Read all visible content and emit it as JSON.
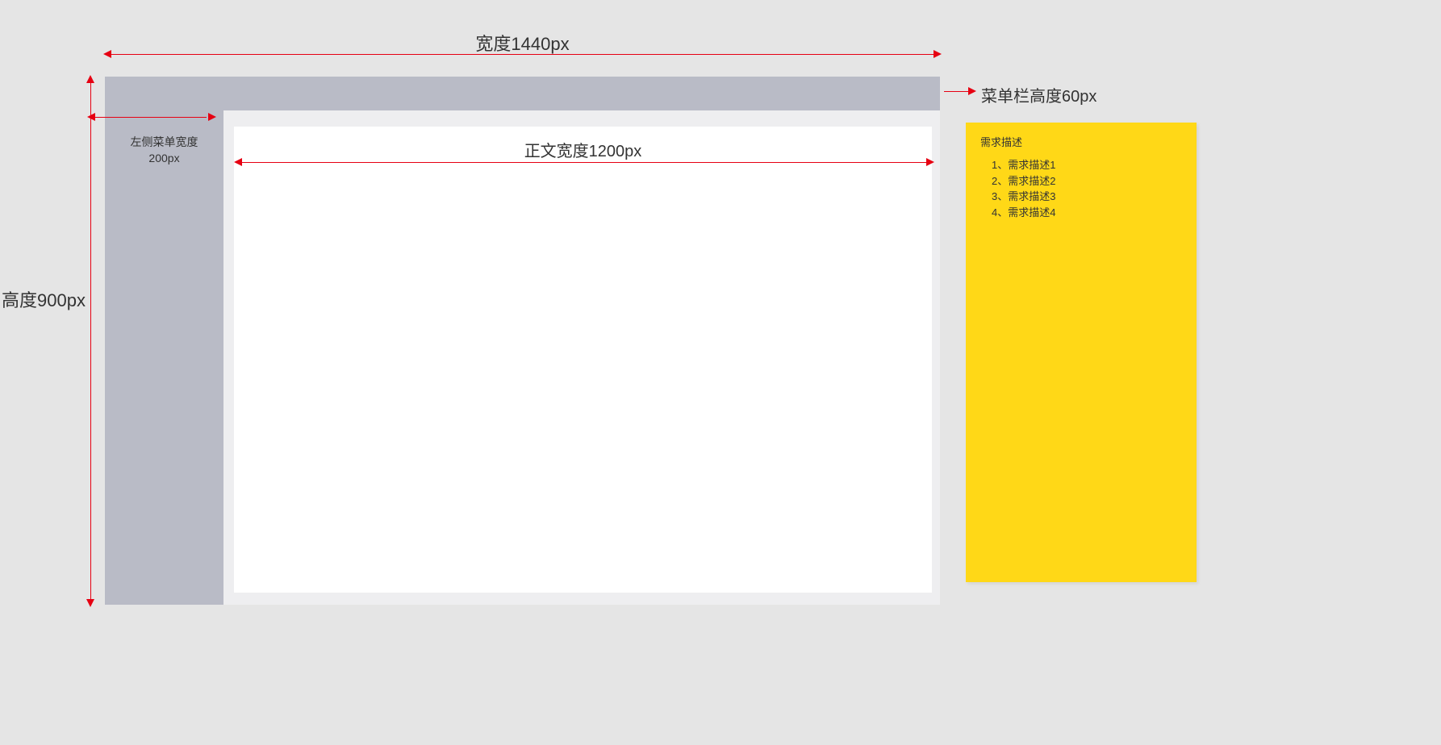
{
  "dimensions": {
    "total_width_label": "宽度1440px",
    "total_height_label": "高度900px",
    "menu_bar_height_label": "菜单栏高度60px",
    "sidebar_width_line1": "左侧菜单宽度",
    "sidebar_width_line2": "200px",
    "content_width_label": "正文宽度1200px"
  },
  "requirements": {
    "title": "需求描述",
    "items": [
      "1、需求描述1",
      "2、需求描述2",
      "3、需求描述3",
      "4、需求描述4"
    ]
  },
  "colors": {
    "arrow": "#e60012",
    "panel_bg": "#b9bbc6",
    "requirements_bg": "#ffd817",
    "page_bg": "#e5e5e5"
  }
}
